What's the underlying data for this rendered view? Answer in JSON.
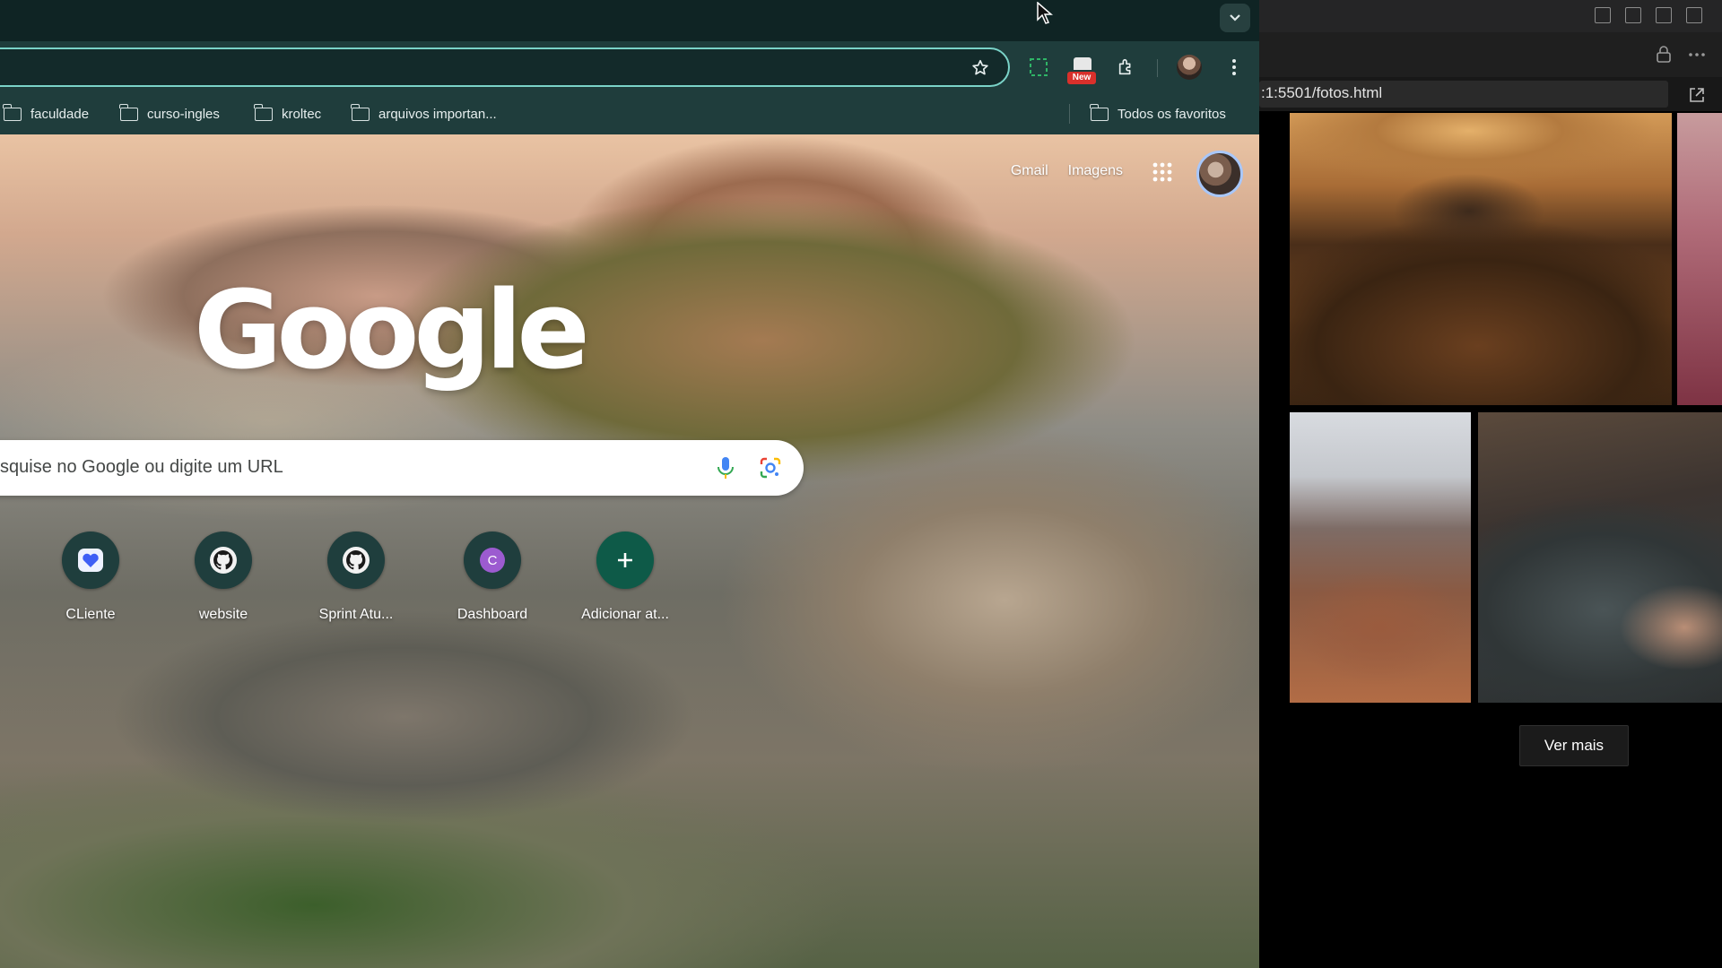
{
  "chrome": {
    "bookmarks": [
      {
        "label": "faculdade"
      },
      {
        "label": "curso-ingles"
      },
      {
        "label": "kroltec"
      },
      {
        "label": "arquivos importan..."
      }
    ],
    "all_bookmarks_label": "Todos os favoritos",
    "extension_badge": "New"
  },
  "ntp": {
    "links": {
      "gmail": "Gmail",
      "images": "Imagens"
    },
    "logo_text": "Google",
    "search_placeholder": "squise no Google ou digite um URL",
    "shortcuts": [
      {
        "label": "CLiente",
        "icon": "heart-app-icon"
      },
      {
        "label": "website",
        "icon": "github-icon"
      },
      {
        "label": "Sprint Atu...",
        "icon": "github-icon"
      },
      {
        "label": "Dashboard",
        "icon": "letter-c-icon",
        "letter": "C"
      },
      {
        "label": "Adicionar at...",
        "icon": "plus-icon"
      }
    ]
  },
  "preview": {
    "url": ":1:5501/fotos.html",
    "button_label": "Ver mais"
  },
  "colors": {
    "omnibox_border": "#7ad3c8",
    "chrome_frame": "#1f3d3c",
    "add_shortcut": "#0e5a48"
  }
}
